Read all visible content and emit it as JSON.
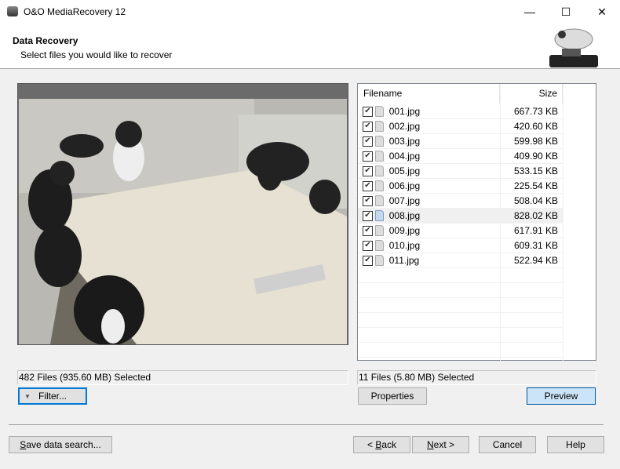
{
  "window": {
    "title": "O&O MediaRecovery 12",
    "minimize": "—",
    "maximize": "☐",
    "close": "✕"
  },
  "header": {
    "title": "Data Recovery",
    "subtitle": "Select files you would like to recover"
  },
  "file_list": {
    "columns": [
      "Filename",
      "Size"
    ],
    "rows": [
      {
        "name": "001.jpg",
        "size": "667.73 KB",
        "checked": true
      },
      {
        "name": "002.jpg",
        "size": "420.60 KB",
        "checked": true
      },
      {
        "name": "003.jpg",
        "size": "599.98 KB",
        "checked": true
      },
      {
        "name": "004.jpg",
        "size": "409.90 KB",
        "checked": true
      },
      {
        "name": "005.jpg",
        "size": "533.15 KB",
        "checked": true
      },
      {
        "name": "006.jpg",
        "size": "225.54 KB",
        "checked": true
      },
      {
        "name": "007.jpg",
        "size": "508.04 KB",
        "checked": true
      },
      {
        "name": "008.jpg",
        "size": "828.02 KB",
        "checked": true,
        "selected": true
      },
      {
        "name": "009.jpg",
        "size": "617.91 KB",
        "checked": true
      },
      {
        "name": "010.jpg",
        "size": "609.31 KB",
        "checked": true
      },
      {
        "name": "011.jpg",
        "size": "522.94 KB",
        "checked": true
      }
    ]
  },
  "status": {
    "left": "482 Files (935.60 MB) Selected",
    "right": "11 Files (5.80 MB) Selected"
  },
  "buttons": {
    "filter": "Filter...",
    "properties": "Properties",
    "preview": "Preview",
    "save_prefix": "S",
    "save_rest": "ave data search...",
    "back_prefix": "< ",
    "back_u": "B",
    "back_rest": "ack",
    "next_u": "N",
    "next_rest": "ext >",
    "cancel": "Cancel",
    "help": "Help"
  },
  "colors": {
    "accent": "#0078d7",
    "default_button": "#cce4f7"
  }
}
